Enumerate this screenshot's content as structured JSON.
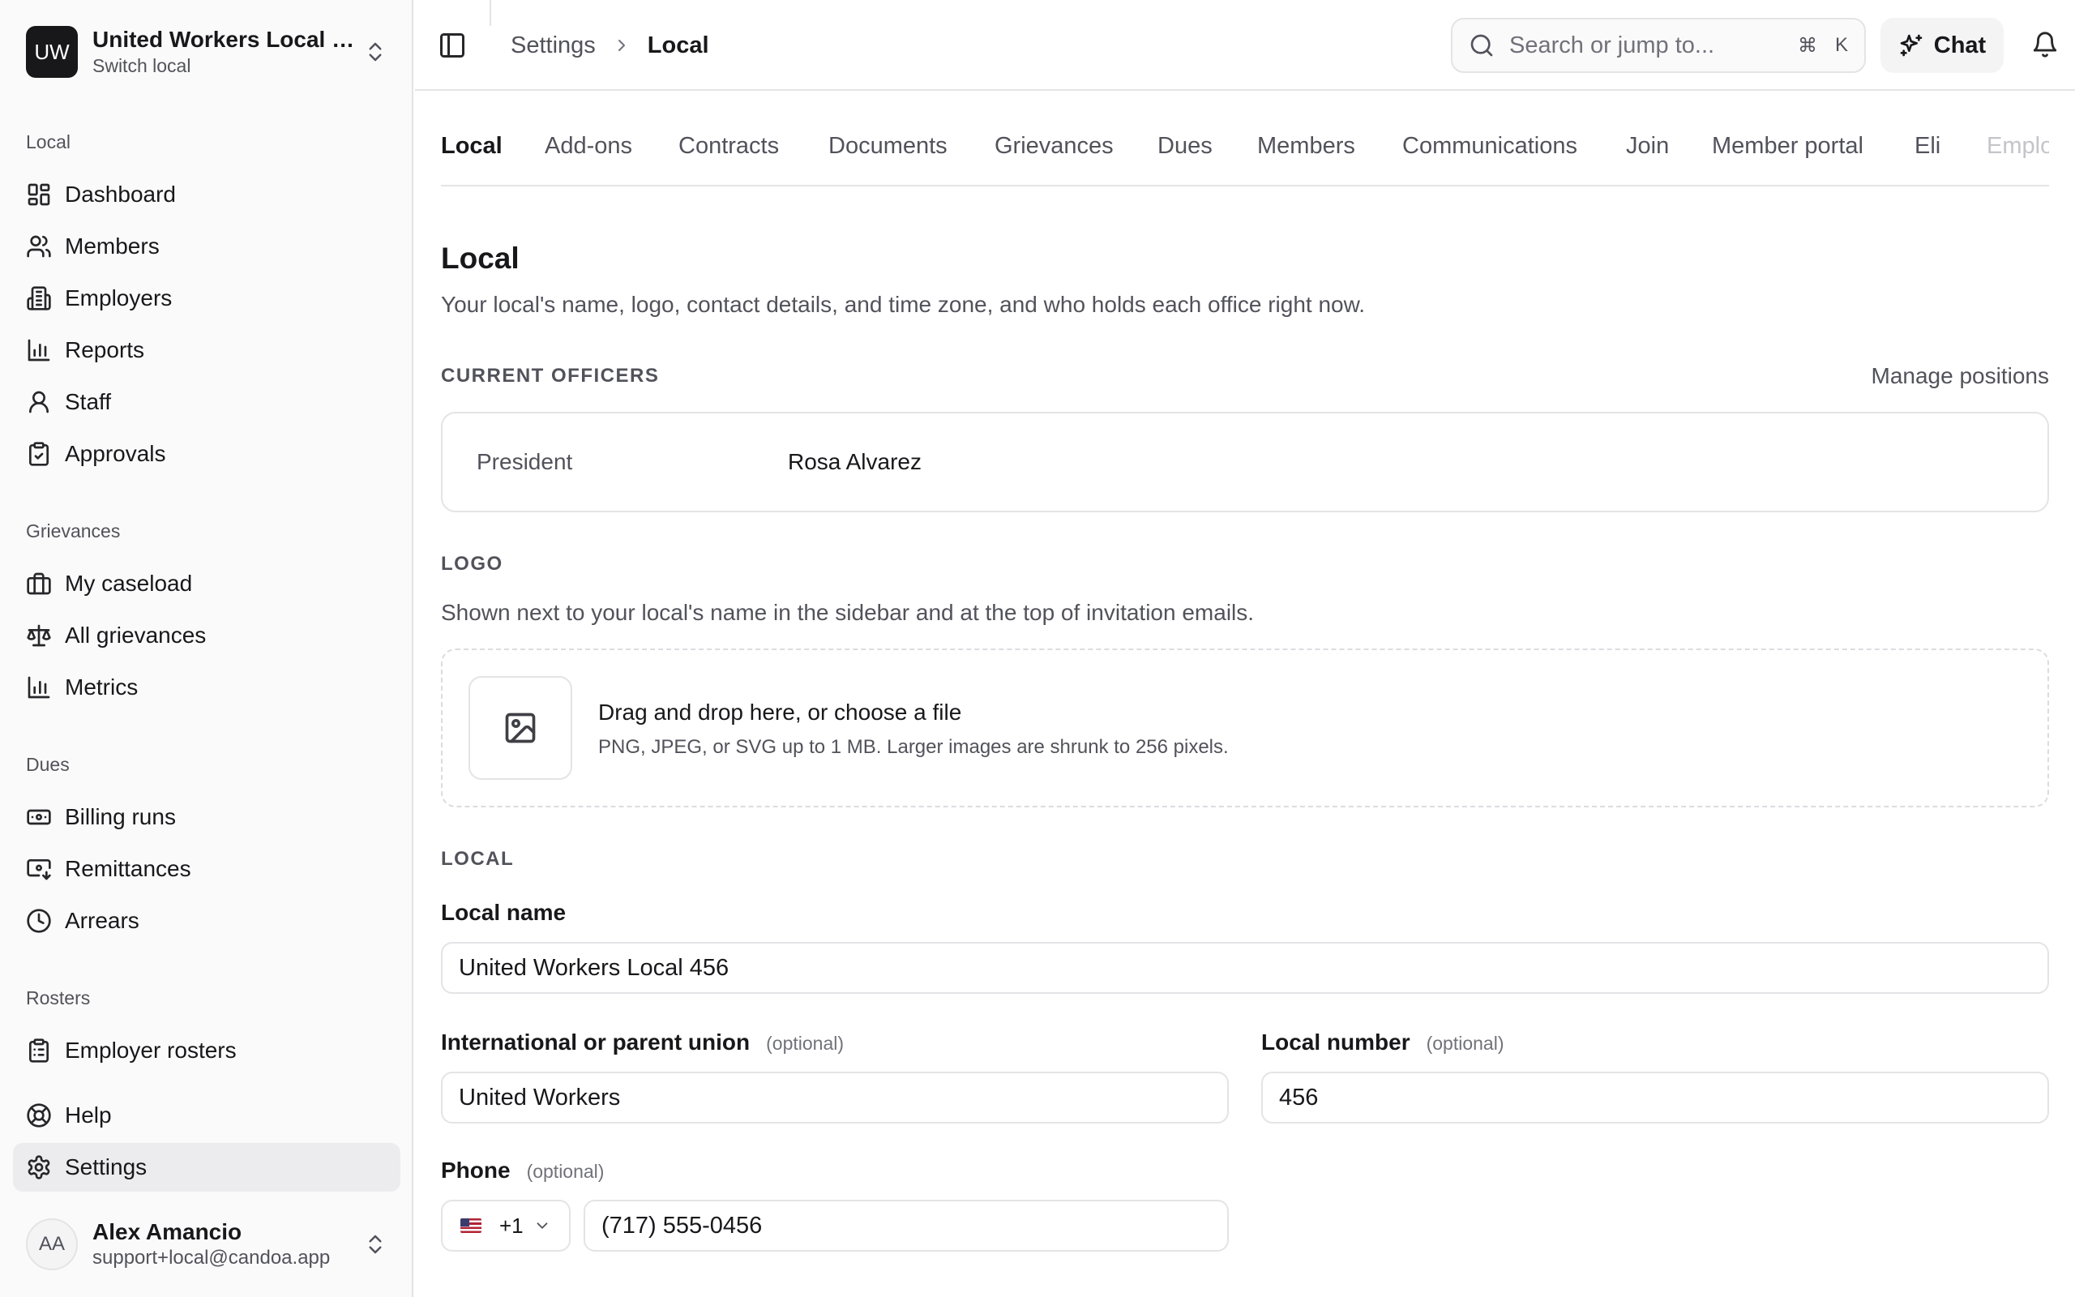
{
  "sidebar": {
    "local": {
      "initials": "UW",
      "name": "United Workers Local 456",
      "subtitle": "Switch local"
    },
    "groups": {
      "local": "Local",
      "grievances": "Grievances",
      "dues": "Dues",
      "rosters": "Rosters"
    },
    "items": {
      "dashboard": "Dashboard",
      "members": "Members",
      "employers": "Employers",
      "reports": "Reports",
      "staff": "Staff",
      "approvals": "Approvals",
      "my_caseload": "My caseload",
      "all_grievances": "All grievances",
      "metrics": "Metrics",
      "billing_runs": "Billing runs",
      "remittances": "Remittances",
      "arrears": "Arrears",
      "employer_rosters": "Employer rosters",
      "help": "Help",
      "settings": "Settings"
    },
    "active_item": "settings",
    "user": {
      "initials": "AA",
      "name": "Alex Amancio",
      "email": "support+local@candoa.app"
    }
  },
  "topbar": {
    "breadcrumb": {
      "parent": "Settings",
      "current": "Local"
    },
    "search": {
      "placeholder": "Search or jump to...",
      "shortcut_mod": "⌘",
      "shortcut_key": "K"
    },
    "chat_label": "Chat"
  },
  "tabs": [
    "Local",
    "Add-ons",
    "Contracts",
    "Documents",
    "Grievances",
    "Dues",
    "Members",
    "Communications",
    "Join",
    "Member portal",
    "Eli",
    "Emplo"
  ],
  "active_tab": "Local",
  "page": {
    "title": "Local",
    "description": "Your local's name, logo, contact details, and time zone, and who holds each office right now."
  },
  "officers": {
    "section_label": "CURRENT OFFICERS",
    "manage_label": "Manage positions",
    "rows": [
      {
        "role": "President",
        "name": "Rosa Alvarez"
      }
    ]
  },
  "logo": {
    "section_label": "LOGO",
    "help": "Shown next to your local's name in the sidebar and at the top of invitation emails.",
    "drop_title": "Drag and drop here, or choose a file",
    "drop_hint": "PNG, JPEG, or SVG up to 1 MB. Larger images are shrunk to 256 pixels."
  },
  "local_section": {
    "section_label": "LOCAL",
    "optional_tag": "(optional)",
    "local_name": {
      "label": "Local name",
      "value": "United Workers Local 456"
    },
    "parent_union": {
      "label": "International or parent union",
      "value": "United Workers"
    },
    "local_number": {
      "label": "Local number",
      "value": "456"
    },
    "phone": {
      "label": "Phone",
      "country_code": "+1",
      "value": "(717) 555-0456"
    }
  }
}
